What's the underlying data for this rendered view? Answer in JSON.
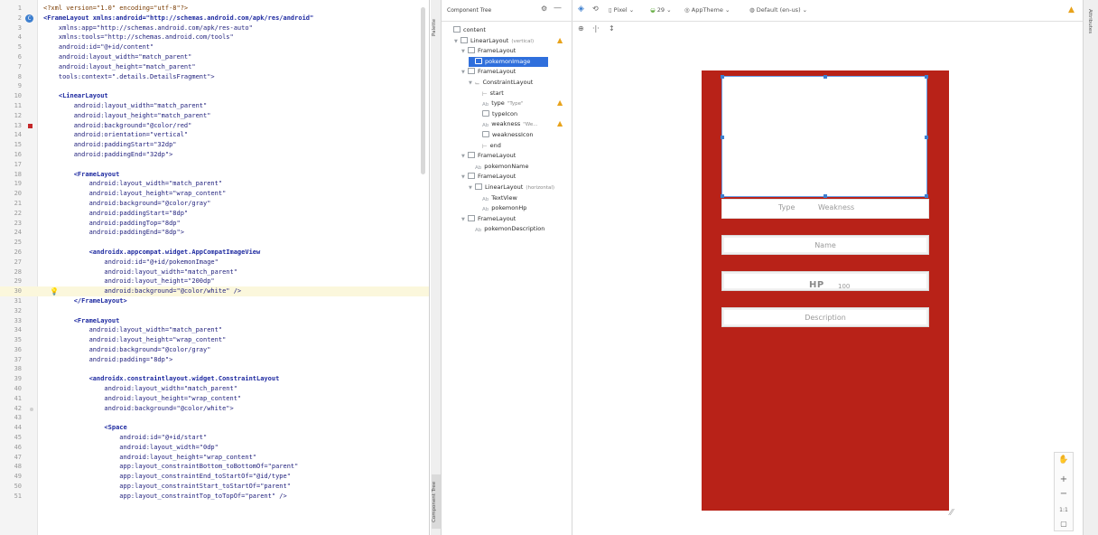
{
  "editor": {
    "lines": [
      {
        "n": "1",
        "text": "<?xml version=\"1.0\" encoding=\"utf-8\"?>",
        "cls": "pi"
      },
      {
        "n": "2",
        "text": "<FrameLayout xmlns:android=\"http://schemas.android.com/apk/res/android\"",
        "cls": "tag",
        "mark": "circle"
      },
      {
        "n": "3",
        "text": "    xmlns:app=\"http://schemas.android.com/apk/res-auto\""
      },
      {
        "n": "4",
        "text": "    xmlns:tools=\"http://schemas.android.com/tools\""
      },
      {
        "n": "5",
        "text": "    android:id=\"@+id/content\""
      },
      {
        "n": "6",
        "text": "    android:layout_width=\"match_parent\""
      },
      {
        "n": "7",
        "text": "    android:layout_height=\"match_parent\""
      },
      {
        "n": "8",
        "text": "    tools:context=\".details.DetailsFragment\">"
      },
      {
        "n": "9",
        "text": ""
      },
      {
        "n": "10",
        "text": "    <LinearLayout",
        "cls": "tag y"
      },
      {
        "n": "11",
        "text": "        android:layout_width=\"match_parent\""
      },
      {
        "n": "12",
        "text": "        android:layout_height=\"match_parent\""
      },
      {
        "n": "13",
        "text": "        android:background=\"@color/red\"",
        "mark": "sq"
      },
      {
        "n": "14",
        "text": "        android:orientation=\"vertical\""
      },
      {
        "n": "15",
        "text": "        android:paddingStart=\"32dp\""
      },
      {
        "n": "16",
        "text": "        android:paddingEnd=\"32dp\">"
      },
      {
        "n": "17",
        "text": ""
      },
      {
        "n": "18",
        "text": "        <FrameLayout",
        "cls": "tag"
      },
      {
        "n": "19",
        "text": "            android:layout_width=\"match_parent\""
      },
      {
        "n": "20",
        "text": "            android:layout_height=\"wrap_content\""
      },
      {
        "n": "21",
        "text": "            android:background=\"@color/gray\""
      },
      {
        "n": "22",
        "text": "            android:paddingStart=\"8dp\""
      },
      {
        "n": "23",
        "text": "            android:paddingTop=\"8dp\""
      },
      {
        "n": "24",
        "text": "            android:paddingEnd=\"8dp\">"
      },
      {
        "n": "25",
        "text": ""
      },
      {
        "n": "26",
        "text": "            <androidx.appcompat.widget.AppCompatImageView",
        "cls": "tag"
      },
      {
        "n": "27",
        "text": "                android:id=\"@+id/pokemonImage\""
      },
      {
        "n": "28",
        "text": "                android:layout_width=\"match_parent\""
      },
      {
        "n": "29",
        "text": "                android:layout_height=\"200dp\""
      },
      {
        "n": "30",
        "text": "                android:background=\"@color/white\" />",
        "hl": true,
        "mark": "bulb"
      },
      {
        "n": "31",
        "text": "        </FrameLayout>",
        "cls": "tag"
      },
      {
        "n": "32",
        "text": ""
      },
      {
        "n": "33",
        "text": "        <FrameLayout",
        "cls": "tag"
      },
      {
        "n": "34",
        "text": "            android:layout_width=\"match_parent\""
      },
      {
        "n": "35",
        "text": "            android:layout_height=\"wrap_content\""
      },
      {
        "n": "36",
        "text": "            android:background=\"@color/gray\""
      },
      {
        "n": "37",
        "text": "            android:padding=\"8dp\">"
      },
      {
        "n": "38",
        "text": ""
      },
      {
        "n": "39",
        "text": "            <androidx.constraintlayout.widget.ConstraintLayout",
        "cls": "tag"
      },
      {
        "n": "40",
        "text": "                android:layout_width=\"match_parent\""
      },
      {
        "n": "41",
        "text": "                android:layout_height=\"wrap_content\""
      },
      {
        "n": "42",
        "text": "                android:background=\"@color/white\">",
        "mark": "dot"
      },
      {
        "n": "43",
        "text": ""
      },
      {
        "n": "44",
        "text": "                <Space",
        "cls": "tag"
      },
      {
        "n": "45",
        "text": "                    android:id=\"@+id/start\""
      },
      {
        "n": "46",
        "text": "                    android:layout_width=\"0dp\""
      },
      {
        "n": "47",
        "text": "                    android:layout_height=\"wrap_content\""
      },
      {
        "n": "48",
        "text": "                    app:layout_constraintBottom_toBottomOf=\"parent\""
      },
      {
        "n": "49",
        "text": "                    app:layout_constraintEnd_toStartOf=\"@id/type\""
      },
      {
        "n": "50",
        "text": "                    app:layout_constraintStart_toStartOf=\"parent\""
      },
      {
        "n": "51",
        "text": "                    app:layout_constraintTop_toTopOf=\"parent\" />"
      }
    ]
  },
  "palette_strip": {
    "palette": "Palette",
    "component_tree": "Component Tree"
  },
  "tree": {
    "title": "Component Tree",
    "nodes": [
      {
        "label": "content",
        "icon": "box",
        "indent": 0,
        "arrow": ""
      },
      {
        "label": "LinearLayout",
        "sub": "(vertical)",
        "icon": "box",
        "indent": 1,
        "arrow": "▼",
        "warn": true
      },
      {
        "label": "FrameLayout",
        "icon": "box",
        "indent": 2,
        "arrow": "▼"
      },
      {
        "label": "pokemonImage",
        "icon": "img",
        "indent": 3,
        "arrow": "",
        "selected": true
      },
      {
        "label": "FrameLayout",
        "icon": "box",
        "indent": 2,
        "arrow": "▼"
      },
      {
        "label": "ConstraintLayout",
        "icon": "cl",
        "indent": 3,
        "arrow": "▼"
      },
      {
        "label": "start",
        "icon": "space",
        "indent": 4,
        "arrow": ""
      },
      {
        "label": "type",
        "sub": "\"Type\"",
        "icon": "txt",
        "indent": 4,
        "arrow": "",
        "warn": true
      },
      {
        "label": "typeIcon",
        "icon": "img",
        "indent": 4,
        "arrow": ""
      },
      {
        "label": "weakness",
        "sub": "\"We...",
        "icon": "txt",
        "indent": 4,
        "arrow": "",
        "warn": true
      },
      {
        "label": "weaknessIcon",
        "icon": "img",
        "indent": 4,
        "arrow": ""
      },
      {
        "label": "end",
        "icon": "space",
        "indent": 4,
        "arrow": ""
      },
      {
        "label": "FrameLayout",
        "icon": "box",
        "indent": 2,
        "arrow": "▼"
      },
      {
        "label": "pokemonName",
        "icon": "txt",
        "indent": 3,
        "arrow": ""
      },
      {
        "label": "FrameLayout",
        "icon": "box",
        "indent": 2,
        "arrow": "▼"
      },
      {
        "label": "LinearLayout",
        "sub": "(horizontal)",
        "icon": "hl",
        "indent": 3,
        "arrow": "▼"
      },
      {
        "label": "TextView",
        "icon": "txt",
        "indent": 4,
        "arrow": ""
      },
      {
        "label": "pokemonHp",
        "icon": "txt",
        "indent": 4,
        "arrow": ""
      },
      {
        "label": "FrameLayout",
        "icon": "box",
        "indent": 2,
        "arrow": "▼"
      },
      {
        "label": "pokemonDescription",
        "icon": "txt",
        "indent": 3,
        "arrow": ""
      }
    ]
  },
  "toolbar": {
    "device": "Pixel",
    "api": "29",
    "theme": "AppTheme",
    "locale": "Default (en-us)"
  },
  "preview": {
    "type": "Type",
    "weakness": "Weakness",
    "name": "Name",
    "hp_label": "HP",
    "hp_value": "100",
    "description": "Description"
  },
  "zoom": {
    "zoom_in": "+",
    "zoom_out": "−",
    "actual": "1:1"
  },
  "attributes": {
    "label": "Attributes"
  },
  "colors": {
    "phone_bg": "#b82218",
    "selection": "#2f6fdc",
    "warning": "#e8a21a"
  }
}
